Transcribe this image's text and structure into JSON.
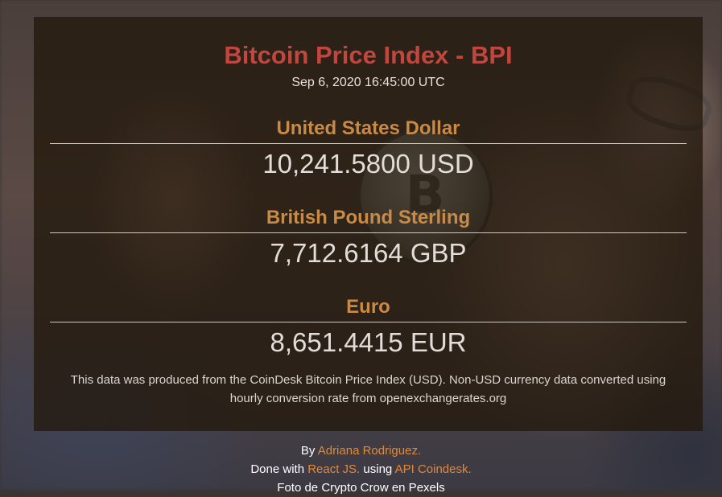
{
  "header": {
    "title": "Bitcoin Price Index - BPI",
    "updated": "Sep 6, 2020 16:45:00 UTC"
  },
  "currencies": [
    {
      "name": "United States Dollar",
      "value": "10,241.5800 USD"
    },
    {
      "name": "British Pound Sterling",
      "value": "7,712.6164 GBP"
    },
    {
      "name": "Euro",
      "value": "8,651.4415 EUR"
    }
  ],
  "disclaimer": "This data was produced from the CoinDesk Bitcoin Price Index (USD). Non-USD currency data converted using hourly conversion rate from openexchangerates.org",
  "footer": {
    "by_prefix": "By",
    "author_link": "Adriana Rodriguez.",
    "done_prefix": "Done with",
    "react_link": "React JS.",
    "using_text": "using",
    "api_link": "API Coindesk.",
    "photo_credit": "Foto de Crypto Crow en Pexels"
  },
  "colors": {
    "title": "#c0463e",
    "currency_name": "#c98a45",
    "link": "#e0893a"
  }
}
